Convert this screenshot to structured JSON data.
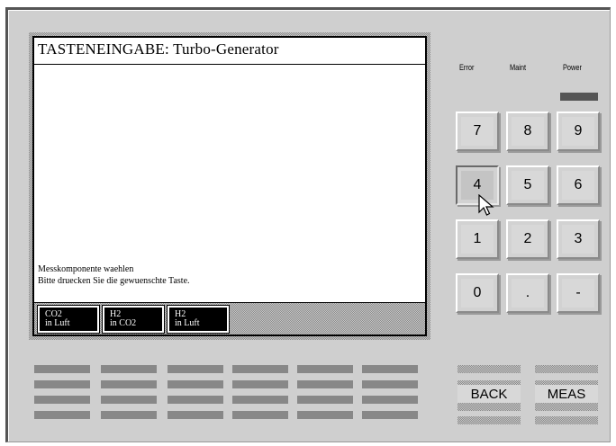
{
  "screen": {
    "title": "TASTENEINGABE: Turbo-Generator",
    "message_line1": "Messkomponente waehlen",
    "message_line2": "Bitte druecken Sie die gewuenschte Taste."
  },
  "softkeys": [
    {
      "line1": "CO2",
      "line2": "in Luft"
    },
    {
      "line1": "H2",
      "line2": "in CO2"
    },
    {
      "line1": "H2",
      "line2": "in Luft"
    }
  ],
  "indicators": {
    "error": "Error",
    "maint": "Maint",
    "power": "Power"
  },
  "keypad": [
    "7",
    "8",
    "9",
    "4",
    "5",
    "6",
    "1",
    "2",
    "3",
    "0",
    ".",
    "-"
  ],
  "buttons": {
    "back": "BACK",
    "meas": "MEAS"
  },
  "colors": {
    "panel": "#cfcfcf",
    "screen_bg": "#ffffff",
    "softkey_bg": "#000000",
    "power_led": "#555555"
  }
}
